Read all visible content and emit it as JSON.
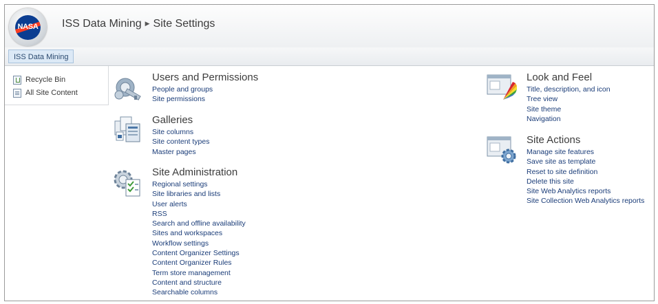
{
  "header": {
    "logo_text": "NASA",
    "breadcrumb": [
      {
        "label": "ISS Data Mining"
      },
      {
        "label": "Site Settings"
      }
    ],
    "separator": "▶"
  },
  "topnav": {
    "tab_label": "ISS Data Mining"
  },
  "quicklaunch": {
    "items": [
      {
        "label": "Recycle Bin",
        "icon": "recycle-bin-icon"
      },
      {
        "label": "All Site Content",
        "icon": "site-content-icon"
      }
    ]
  },
  "sections": {
    "users": {
      "title": "Users and Permissions",
      "icon": "users-permissions-icon",
      "links": [
        "People and groups",
        "Site permissions"
      ]
    },
    "galleries": {
      "title": "Galleries",
      "icon": "galleries-icon",
      "links": [
        "Site columns",
        "Site content types",
        "Master pages"
      ]
    },
    "admin": {
      "title": "Site Administration",
      "icon": "site-administration-icon",
      "links": [
        "Regional settings",
        "Site libraries and lists",
        "User alerts",
        "RSS",
        "Search and offline availability",
        "Sites and workspaces",
        "Workflow settings",
        "Content Organizer Settings",
        "Content Organizer Rules",
        "Term store management",
        "Content and structure",
        "Searchable columns"
      ]
    },
    "look": {
      "title": "Look and Feel",
      "icon": "look-and-feel-icon",
      "links": [
        "Title, description, and icon",
        "Tree view",
        "Site theme",
        "Navigation"
      ]
    },
    "actions": {
      "title": "Site Actions",
      "icon": "site-actions-icon",
      "links": [
        "Manage site features",
        "Save site as template",
        "Reset to site definition",
        "Delete this site",
        "Site Web Analytics reports",
        "Site Collection Web Analytics reports"
      ]
    }
  },
  "colors": {
    "link": "#1a3c78",
    "title": "#3c3c3c",
    "nasa_blue": "#0b3d91",
    "nasa_red": "#fc3d21"
  }
}
